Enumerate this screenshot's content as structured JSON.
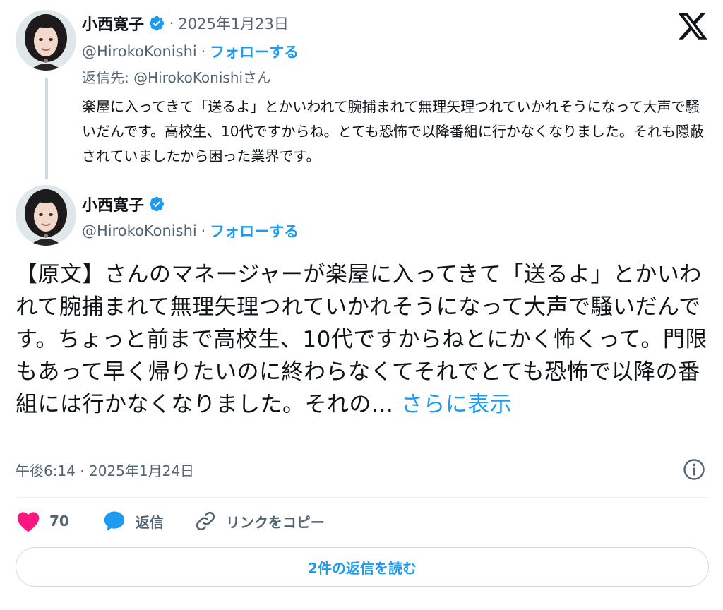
{
  "parent_tweet": {
    "display_name": "小西寛子",
    "date": "2025年1月23日",
    "handle": "@HirokoKonishi",
    "follow_label": "フォローする",
    "reply_to": "返信先: @HirokoKonishiさん",
    "text": "楽屋に入ってきて「送るよ」とかいわれて腕捕まれて無理矢理つれていかれそうになって大声で騒いだんです。高校生、10代ですからね。とても恐怖で以降番組に行かなくなりました。それも隠蔽されていましたから困った業界です。"
  },
  "main_tweet": {
    "display_name": "小西寛子",
    "handle": "@HirokoKonishi",
    "follow_label": "フォローする",
    "text": "【原文】さんのマネージャーが楽屋に入ってきて「送るよ」とかいわれて腕捕まれて無理矢理つれていかれそうになって大声で騒いだんです。ちょっと前まで高校生、10代ですからねとにかく怖くって。門限もあって早く帰りたいのに終わらなくてそれでとても恐怖で以降の番組には行かなくなりました。それの…",
    "show_more": "さらに表示",
    "timestamp": "午後6:14 · 2025年1月24日",
    "like_count": "70",
    "reply_label": "返信",
    "copy_link_label": "リンクをコピー",
    "read_replies_label": "2件の返信を読む"
  },
  "separator": "·",
  "icons": {
    "brand": "x-logo-icon",
    "verified": "verified-badge-icon",
    "info": "info-icon",
    "like": "heart-icon",
    "reply": "speech-bubble-icon",
    "link": "link-icon"
  },
  "colors": {
    "accent": "#1d9bf0",
    "like": "#f91880",
    "text": "#0f1419",
    "muted": "#536471",
    "border": "#cfd9de"
  }
}
